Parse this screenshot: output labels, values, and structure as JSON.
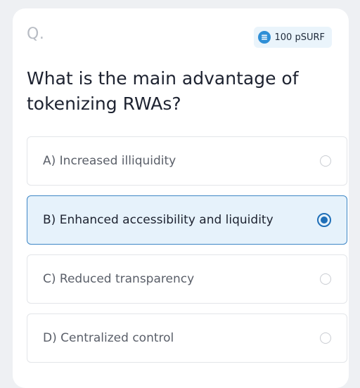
{
  "header": {
    "q_label": "Q.",
    "reward": "100 pSURF",
    "reward_icon": "coin-icon"
  },
  "question": {
    "text": "What is the main advantage of tokenizing RWAs?"
  },
  "options": [
    {
      "label": "A) Increased illiquidity",
      "selected": false
    },
    {
      "label": "B) Enhanced accessibility and liquidity",
      "selected": true
    },
    {
      "label": "C) Reduced transparency",
      "selected": false
    },
    {
      "label": "D) Centralized control",
      "selected": false
    }
  ],
  "colors": {
    "accent": "#1f6fb8",
    "selected_bg": "#e6f2fb",
    "selected_border": "#3d86c6"
  }
}
